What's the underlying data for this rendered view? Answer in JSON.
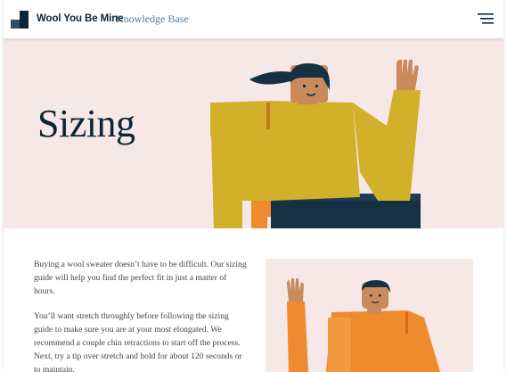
{
  "header": {
    "brand": "Wool You Be Mine",
    "section": "Knowledge Base",
    "menu_icon": "hamburger-menu-icon"
  },
  "hero": {
    "title": "Sizing"
  },
  "content": {
    "paragraph_1": "Buying a wool sweater doesn’t have to be difficult. Our sizing guide will help you find the perfect fit in just a matter of hours.",
    "paragraph_2": "You’ll want stretch throughly before following the sizing guide to make sure you are at your most elongated. We recommend a couple chin retractions to start off the process. Next, try a tip over stretch and hold for about 120 seconds or to maintain."
  },
  "colors": {
    "navy": "#0d2637",
    "link_blue": "#3e7da8",
    "hero_bg": "#f5e8e6",
    "mustard": "#d3b02a",
    "orange": "#f08a2e",
    "skin": "#c98b5c"
  }
}
